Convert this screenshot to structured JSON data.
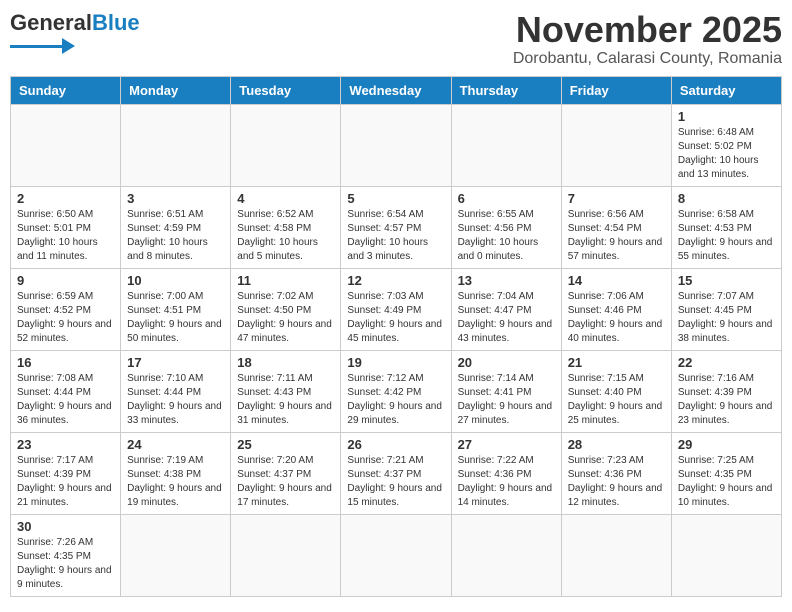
{
  "header": {
    "logo_general": "General",
    "logo_blue": "Blue",
    "month_title": "November 2025",
    "location": "Dorobantu, Calarasi County, Romania"
  },
  "days_of_week": [
    "Sunday",
    "Monday",
    "Tuesday",
    "Wednesday",
    "Thursday",
    "Friday",
    "Saturday"
  ],
  "weeks": [
    [
      {
        "day": "",
        "info": ""
      },
      {
        "day": "",
        "info": ""
      },
      {
        "day": "",
        "info": ""
      },
      {
        "day": "",
        "info": ""
      },
      {
        "day": "",
        "info": ""
      },
      {
        "day": "",
        "info": ""
      },
      {
        "day": "1",
        "info": "Sunrise: 6:48 AM\nSunset: 5:02 PM\nDaylight: 10 hours and 13 minutes."
      }
    ],
    [
      {
        "day": "2",
        "info": "Sunrise: 6:50 AM\nSunset: 5:01 PM\nDaylight: 10 hours and 11 minutes."
      },
      {
        "day": "3",
        "info": "Sunrise: 6:51 AM\nSunset: 4:59 PM\nDaylight: 10 hours and 8 minutes."
      },
      {
        "day": "4",
        "info": "Sunrise: 6:52 AM\nSunset: 4:58 PM\nDaylight: 10 hours and 5 minutes."
      },
      {
        "day": "5",
        "info": "Sunrise: 6:54 AM\nSunset: 4:57 PM\nDaylight: 10 hours and 3 minutes."
      },
      {
        "day": "6",
        "info": "Sunrise: 6:55 AM\nSunset: 4:56 PM\nDaylight: 10 hours and 0 minutes."
      },
      {
        "day": "7",
        "info": "Sunrise: 6:56 AM\nSunset: 4:54 PM\nDaylight: 9 hours and 57 minutes."
      },
      {
        "day": "8",
        "info": "Sunrise: 6:58 AM\nSunset: 4:53 PM\nDaylight: 9 hours and 55 minutes."
      }
    ],
    [
      {
        "day": "9",
        "info": "Sunrise: 6:59 AM\nSunset: 4:52 PM\nDaylight: 9 hours and 52 minutes."
      },
      {
        "day": "10",
        "info": "Sunrise: 7:00 AM\nSunset: 4:51 PM\nDaylight: 9 hours and 50 minutes."
      },
      {
        "day": "11",
        "info": "Sunrise: 7:02 AM\nSunset: 4:50 PM\nDaylight: 9 hours and 47 minutes."
      },
      {
        "day": "12",
        "info": "Sunrise: 7:03 AM\nSunset: 4:49 PM\nDaylight: 9 hours and 45 minutes."
      },
      {
        "day": "13",
        "info": "Sunrise: 7:04 AM\nSunset: 4:47 PM\nDaylight: 9 hours and 43 minutes."
      },
      {
        "day": "14",
        "info": "Sunrise: 7:06 AM\nSunset: 4:46 PM\nDaylight: 9 hours and 40 minutes."
      },
      {
        "day": "15",
        "info": "Sunrise: 7:07 AM\nSunset: 4:45 PM\nDaylight: 9 hours and 38 minutes."
      }
    ],
    [
      {
        "day": "16",
        "info": "Sunrise: 7:08 AM\nSunset: 4:44 PM\nDaylight: 9 hours and 36 minutes."
      },
      {
        "day": "17",
        "info": "Sunrise: 7:10 AM\nSunset: 4:44 PM\nDaylight: 9 hours and 33 minutes."
      },
      {
        "day": "18",
        "info": "Sunrise: 7:11 AM\nSunset: 4:43 PM\nDaylight: 9 hours and 31 minutes."
      },
      {
        "day": "19",
        "info": "Sunrise: 7:12 AM\nSunset: 4:42 PM\nDaylight: 9 hours and 29 minutes."
      },
      {
        "day": "20",
        "info": "Sunrise: 7:14 AM\nSunset: 4:41 PM\nDaylight: 9 hours and 27 minutes."
      },
      {
        "day": "21",
        "info": "Sunrise: 7:15 AM\nSunset: 4:40 PM\nDaylight: 9 hours and 25 minutes."
      },
      {
        "day": "22",
        "info": "Sunrise: 7:16 AM\nSunset: 4:39 PM\nDaylight: 9 hours and 23 minutes."
      }
    ],
    [
      {
        "day": "23",
        "info": "Sunrise: 7:17 AM\nSunset: 4:39 PM\nDaylight: 9 hours and 21 minutes."
      },
      {
        "day": "24",
        "info": "Sunrise: 7:19 AM\nSunset: 4:38 PM\nDaylight: 9 hours and 19 minutes."
      },
      {
        "day": "25",
        "info": "Sunrise: 7:20 AM\nSunset: 4:37 PM\nDaylight: 9 hours and 17 minutes."
      },
      {
        "day": "26",
        "info": "Sunrise: 7:21 AM\nSunset: 4:37 PM\nDaylight: 9 hours and 15 minutes."
      },
      {
        "day": "27",
        "info": "Sunrise: 7:22 AM\nSunset: 4:36 PM\nDaylight: 9 hours and 14 minutes."
      },
      {
        "day": "28",
        "info": "Sunrise: 7:23 AM\nSunset: 4:36 PM\nDaylight: 9 hours and 12 minutes."
      },
      {
        "day": "29",
        "info": "Sunrise: 7:25 AM\nSunset: 4:35 PM\nDaylight: 9 hours and 10 minutes."
      }
    ],
    [
      {
        "day": "30",
        "info": "Sunrise: 7:26 AM\nSunset: 4:35 PM\nDaylight: 9 hours and 9 minutes."
      },
      {
        "day": "",
        "info": ""
      },
      {
        "day": "",
        "info": ""
      },
      {
        "day": "",
        "info": ""
      },
      {
        "day": "",
        "info": ""
      },
      {
        "day": "",
        "info": ""
      },
      {
        "day": "",
        "info": ""
      }
    ]
  ]
}
